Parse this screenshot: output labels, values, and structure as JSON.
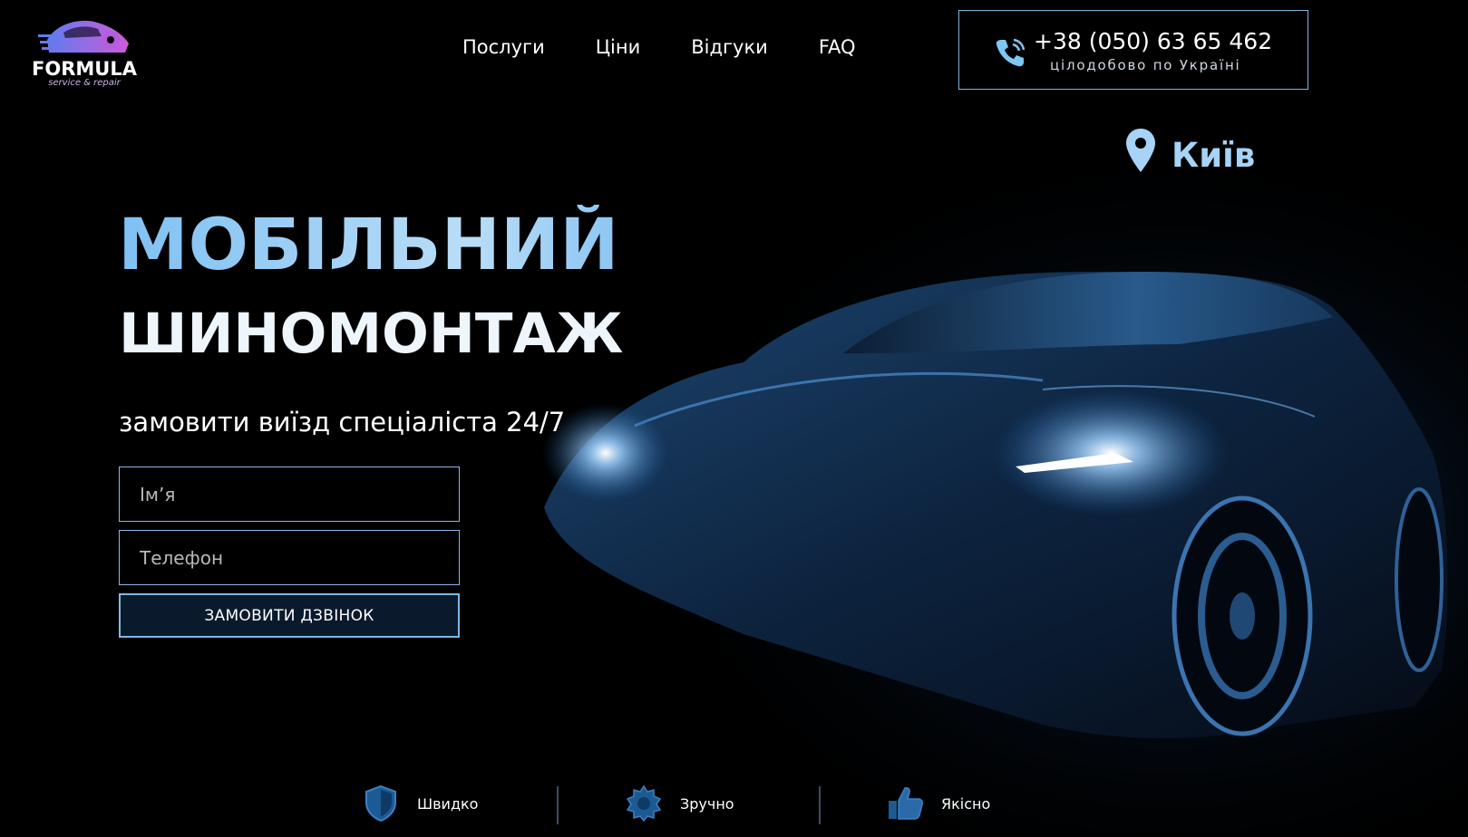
{
  "brand": {
    "name": "FORMULA",
    "tagline": "service & repair"
  },
  "nav": {
    "items": [
      {
        "label": "Послуги"
      },
      {
        "label": "Ціни"
      },
      {
        "label": "Відгуки"
      },
      {
        "label": "FAQ"
      }
    ]
  },
  "contact": {
    "phone": "+38 (050) 63 65 462",
    "note": "цілодобово по Україні",
    "icon": "phone-icon"
  },
  "location": {
    "city": "Київ",
    "icon": "map-pin-icon"
  },
  "hero": {
    "title_line1": "МОБІЛЬНИЙ",
    "title_line2": "ШИНОМОНТАЖ",
    "subtitle": "замовити виїзд спеціаліста 24/7"
  },
  "form": {
    "name_placeholder": "Ім’я",
    "phone_placeholder": "Телефон",
    "submit_label": "ЗАМОВИТИ ДЗВІНОК"
  },
  "features": [
    {
      "label": "Швидко",
      "icon": "shield-icon"
    },
    {
      "label": "Зручно",
      "icon": "badge-icon"
    },
    {
      "label": "Якісно",
      "icon": "thumbs-up-icon"
    }
  ],
  "colors": {
    "background": "#000000",
    "accent": "#8ec8f5",
    "border": "#8ab6e6",
    "logo_gradient_start": "#5f7cf0",
    "logo_gradient_end": "#d05ad8"
  }
}
